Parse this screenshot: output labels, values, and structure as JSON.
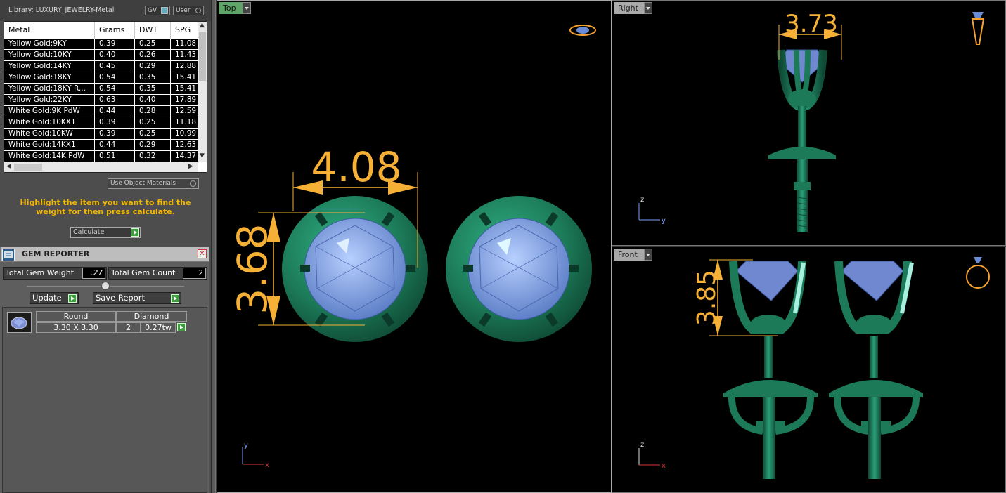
{
  "library": {
    "title": "Library: LUXURY_JEWELRY-Metal",
    "gv_label": "GV",
    "user_label": "User"
  },
  "metal_table": {
    "headers": [
      "Metal",
      "Grams",
      "DWT",
      "SPG"
    ],
    "rows": [
      [
        "Yellow Gold:9KY",
        "0.39",
        "0.25",
        "11.08"
      ],
      [
        "Yellow Gold:10KY",
        "0.40",
        "0.26",
        "11.43"
      ],
      [
        "Yellow Gold:14KY",
        "0.45",
        "0.29",
        "12.88"
      ],
      [
        "Yellow Gold:18KY",
        "0.54",
        "0.35",
        "15.41"
      ],
      [
        "Yellow Gold:18KY R...",
        "0.54",
        "0.35",
        "15.41"
      ],
      [
        "Yellow Gold:22KY",
        "0.63",
        "0.40",
        "17.89"
      ],
      [
        "White Gold:9K PdW",
        "0.44",
        "0.28",
        "12.59"
      ],
      [
        "White Gold:10KX1",
        "0.39",
        "0.25",
        "11.18"
      ],
      [
        "White Gold:10KW",
        "0.39",
        "0.25",
        "10.99"
      ],
      [
        "White Gold:14KX1",
        "0.44",
        "0.29",
        "12.63"
      ],
      [
        "White Gold:14K PdW",
        "0.51",
        "0.32",
        "14.37"
      ]
    ]
  },
  "use_object_materials": "Use Object Materials",
  "hint": "Highlight the item you want to find the weight for then press calculate.",
  "calculate_label": "Calculate",
  "gem_reporter": {
    "title": "GEM REPORTER",
    "total_weight_label": "Total Gem Weight",
    "total_weight_value": ".27",
    "total_count_label": "Total Gem Count",
    "total_count_value": "2",
    "update_label": "Update",
    "save_report_label": "Save Report",
    "gem": {
      "shape": "Round",
      "type": "Diamond",
      "size": "3.30 X 3.30",
      "count": "2",
      "weight": "0.27tw"
    }
  },
  "viewports": {
    "top": {
      "label": "Top",
      "width_dim": "4.08",
      "height_dim": "3.68",
      "axis_x": "x",
      "axis_y": "y"
    },
    "right": {
      "label": "Right",
      "dim": "3.73",
      "axis_z": "z",
      "axis_y": "y"
    },
    "front": {
      "label": "Front",
      "dim": "3.85",
      "axis_z": "z",
      "axis_x": "x"
    }
  },
  "colors": {
    "metal_green": "#1f7a5a",
    "gem_blue": "#8aaef0",
    "dimension_orange": "#f5b035",
    "hint_yellow": "#f5b700",
    "active_tab": "#5fa56a"
  }
}
